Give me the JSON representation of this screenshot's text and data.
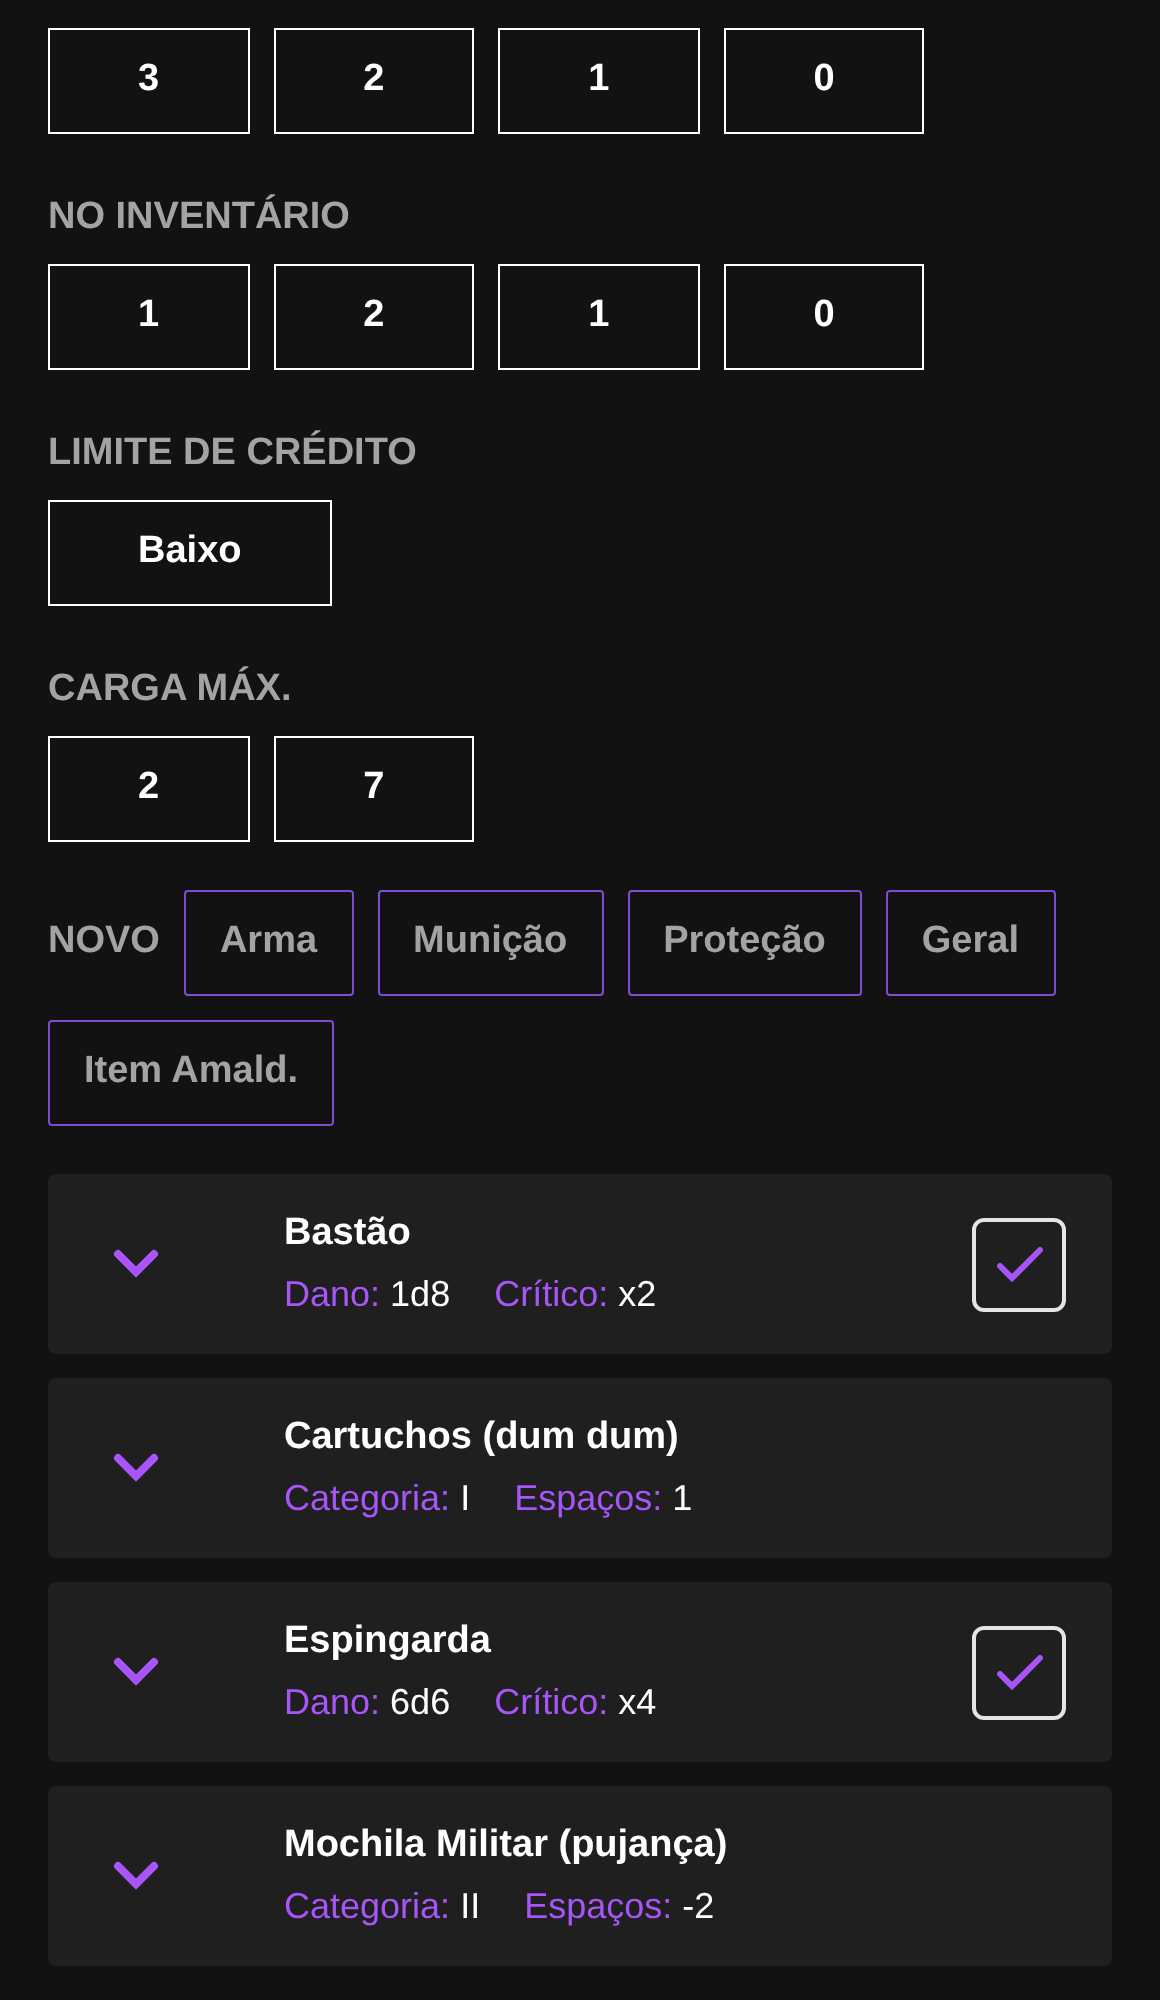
{
  "sections": [
    {
      "boxes": [
        "3",
        "2",
        "1",
        "0"
      ]
    },
    {
      "label": "NO INVENTÁRIO",
      "boxes": [
        "1",
        "2",
        "1",
        "0"
      ]
    },
    {
      "label": "LIMITE DE CRÉDITO",
      "boxes": [
        "Baixo"
      ]
    },
    {
      "label": "CARGA MÁX.",
      "boxes": [
        "2",
        "7"
      ]
    }
  ],
  "new_item": {
    "label": "NOVO",
    "buttons": [
      "Arma",
      "Munição",
      "Proteção",
      "Geral",
      "Item Amald."
    ]
  },
  "items": [
    {
      "kind": "weapon",
      "name": "Bastão",
      "stats": [
        {
          "label": "Dano:",
          "value": "1d8"
        },
        {
          "label": "Crítico:",
          "value": "x2"
        }
      ],
      "equipped": true
    },
    {
      "kind": "gear",
      "name": "Cartuchos (dum dum)",
      "stats": [
        {
          "label": "Categoria:",
          "value": "I"
        },
        {
          "label": "Espaços:",
          "value": "1"
        }
      ]
    },
    {
      "kind": "weapon",
      "name": "Espingarda",
      "stats": [
        {
          "label": "Dano:",
          "value": "6d6"
        },
        {
          "label": "Crítico:",
          "value": "x4"
        }
      ],
      "equipped": true
    },
    {
      "kind": "gear",
      "name": "Mochila Militar (pujança)",
      "stats": [
        {
          "label": "Categoria:",
          "value": "II"
        },
        {
          "label": "Espaços:",
          "value": "-2"
        }
      ]
    }
  ]
}
